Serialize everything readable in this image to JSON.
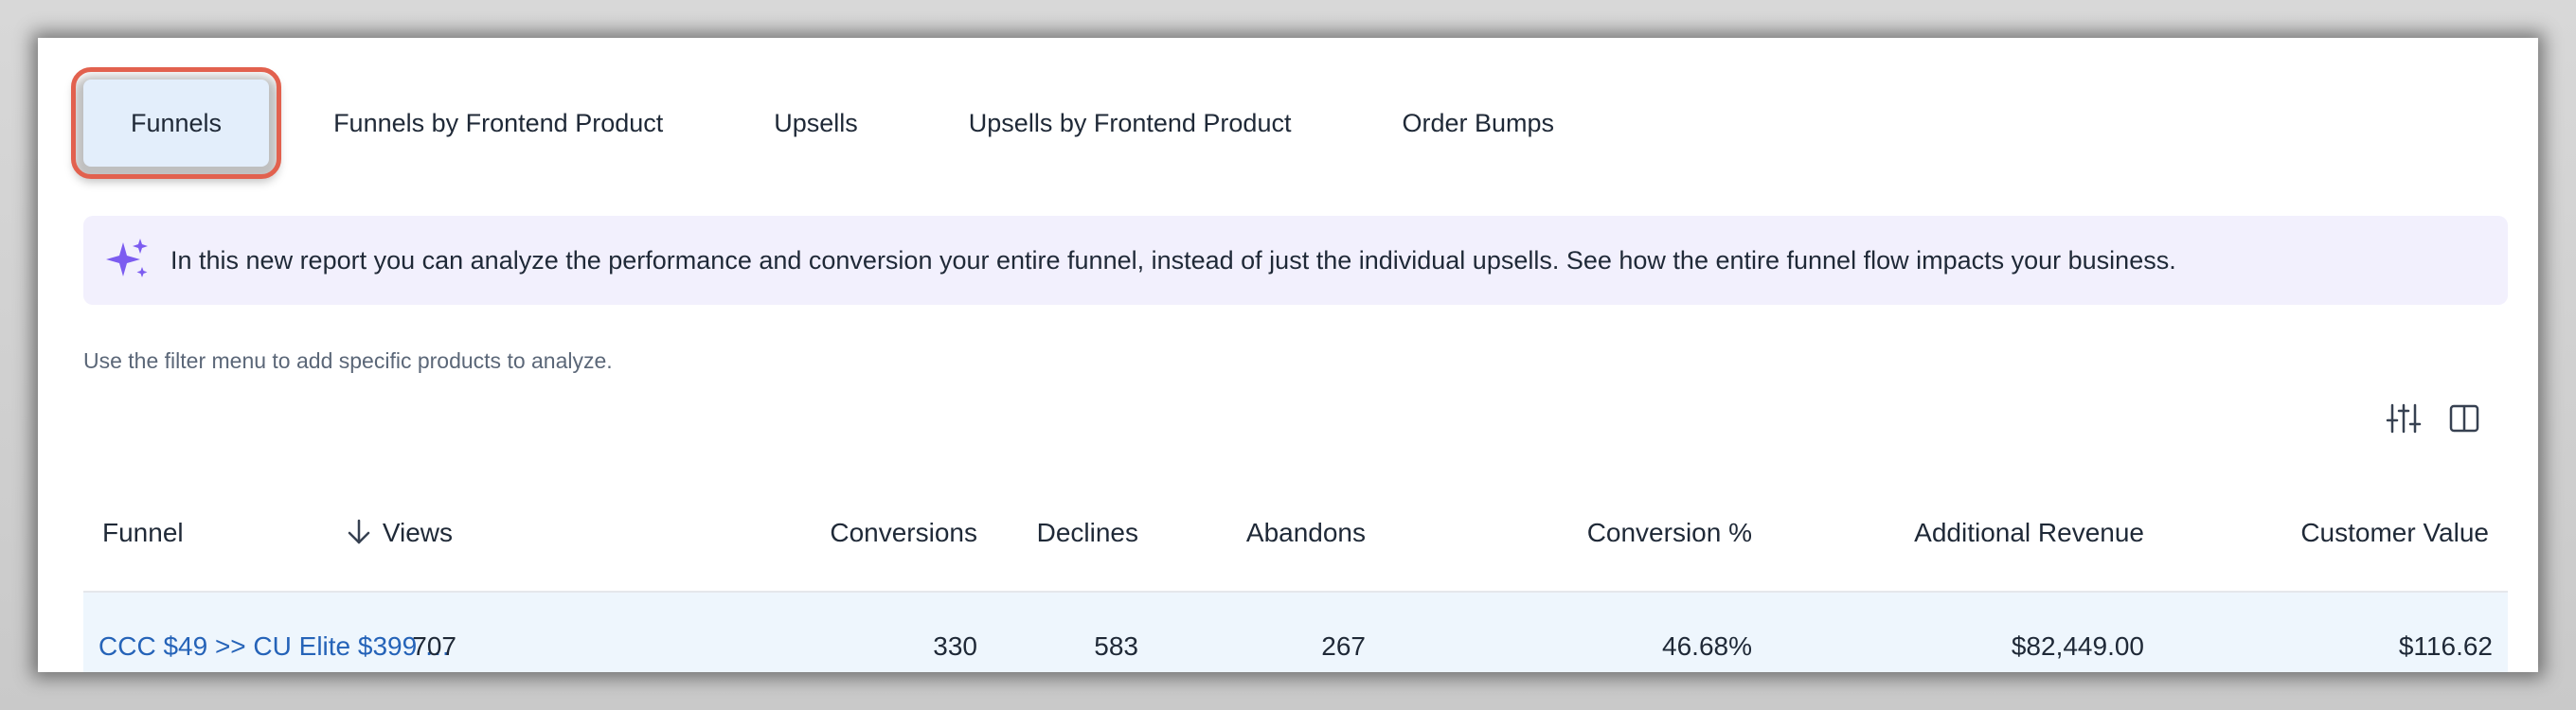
{
  "tabs": [
    {
      "label": "Funnels",
      "active": true
    },
    {
      "label": "Funnels by Frontend Product",
      "active": false
    },
    {
      "label": "Upsells",
      "active": false
    },
    {
      "label": "Upsells by Frontend Product",
      "active": false
    },
    {
      "label": "Order Bumps",
      "active": false
    }
  ],
  "banner": {
    "icon": "sparkles-icon",
    "text": "In this new report you can analyze the performance and conversion your entire funnel, instead of just the individual upsells. See how the entire funnel flow impacts your business."
  },
  "hint": "Use the filter menu to add specific products to analyze.",
  "toolbar": {
    "filter_icon": "sliders-icon",
    "columns_icon": "columns-icon"
  },
  "table": {
    "headers": {
      "funnel": "Funnel",
      "views": "Views",
      "conversions": "Conversions",
      "declines": "Declines",
      "abandons": "Abandons",
      "conversion_pct": "Conversion %",
      "additional_revenue": "Additional Revenue",
      "customer_value": "Customer Value"
    },
    "sort_icon": "arrow-down-icon",
    "rows": [
      {
        "funnel": "CCC $49 >> CU Elite $399 …",
        "views": "707",
        "conversions": "330",
        "declines": "583",
        "abandons": "267",
        "conversion_pct": "46.68%",
        "additional_revenue": "$82,449.00",
        "customer_value": "$116.62"
      }
    ]
  },
  "colors": {
    "accent_outline": "#e2614e",
    "active_tab_bg": "#e3eefb",
    "banner_bg": "#f2f0fd",
    "sparkle": "#7c5cf0",
    "link": "#2563b8",
    "row_bg": "#eef6fd"
  }
}
